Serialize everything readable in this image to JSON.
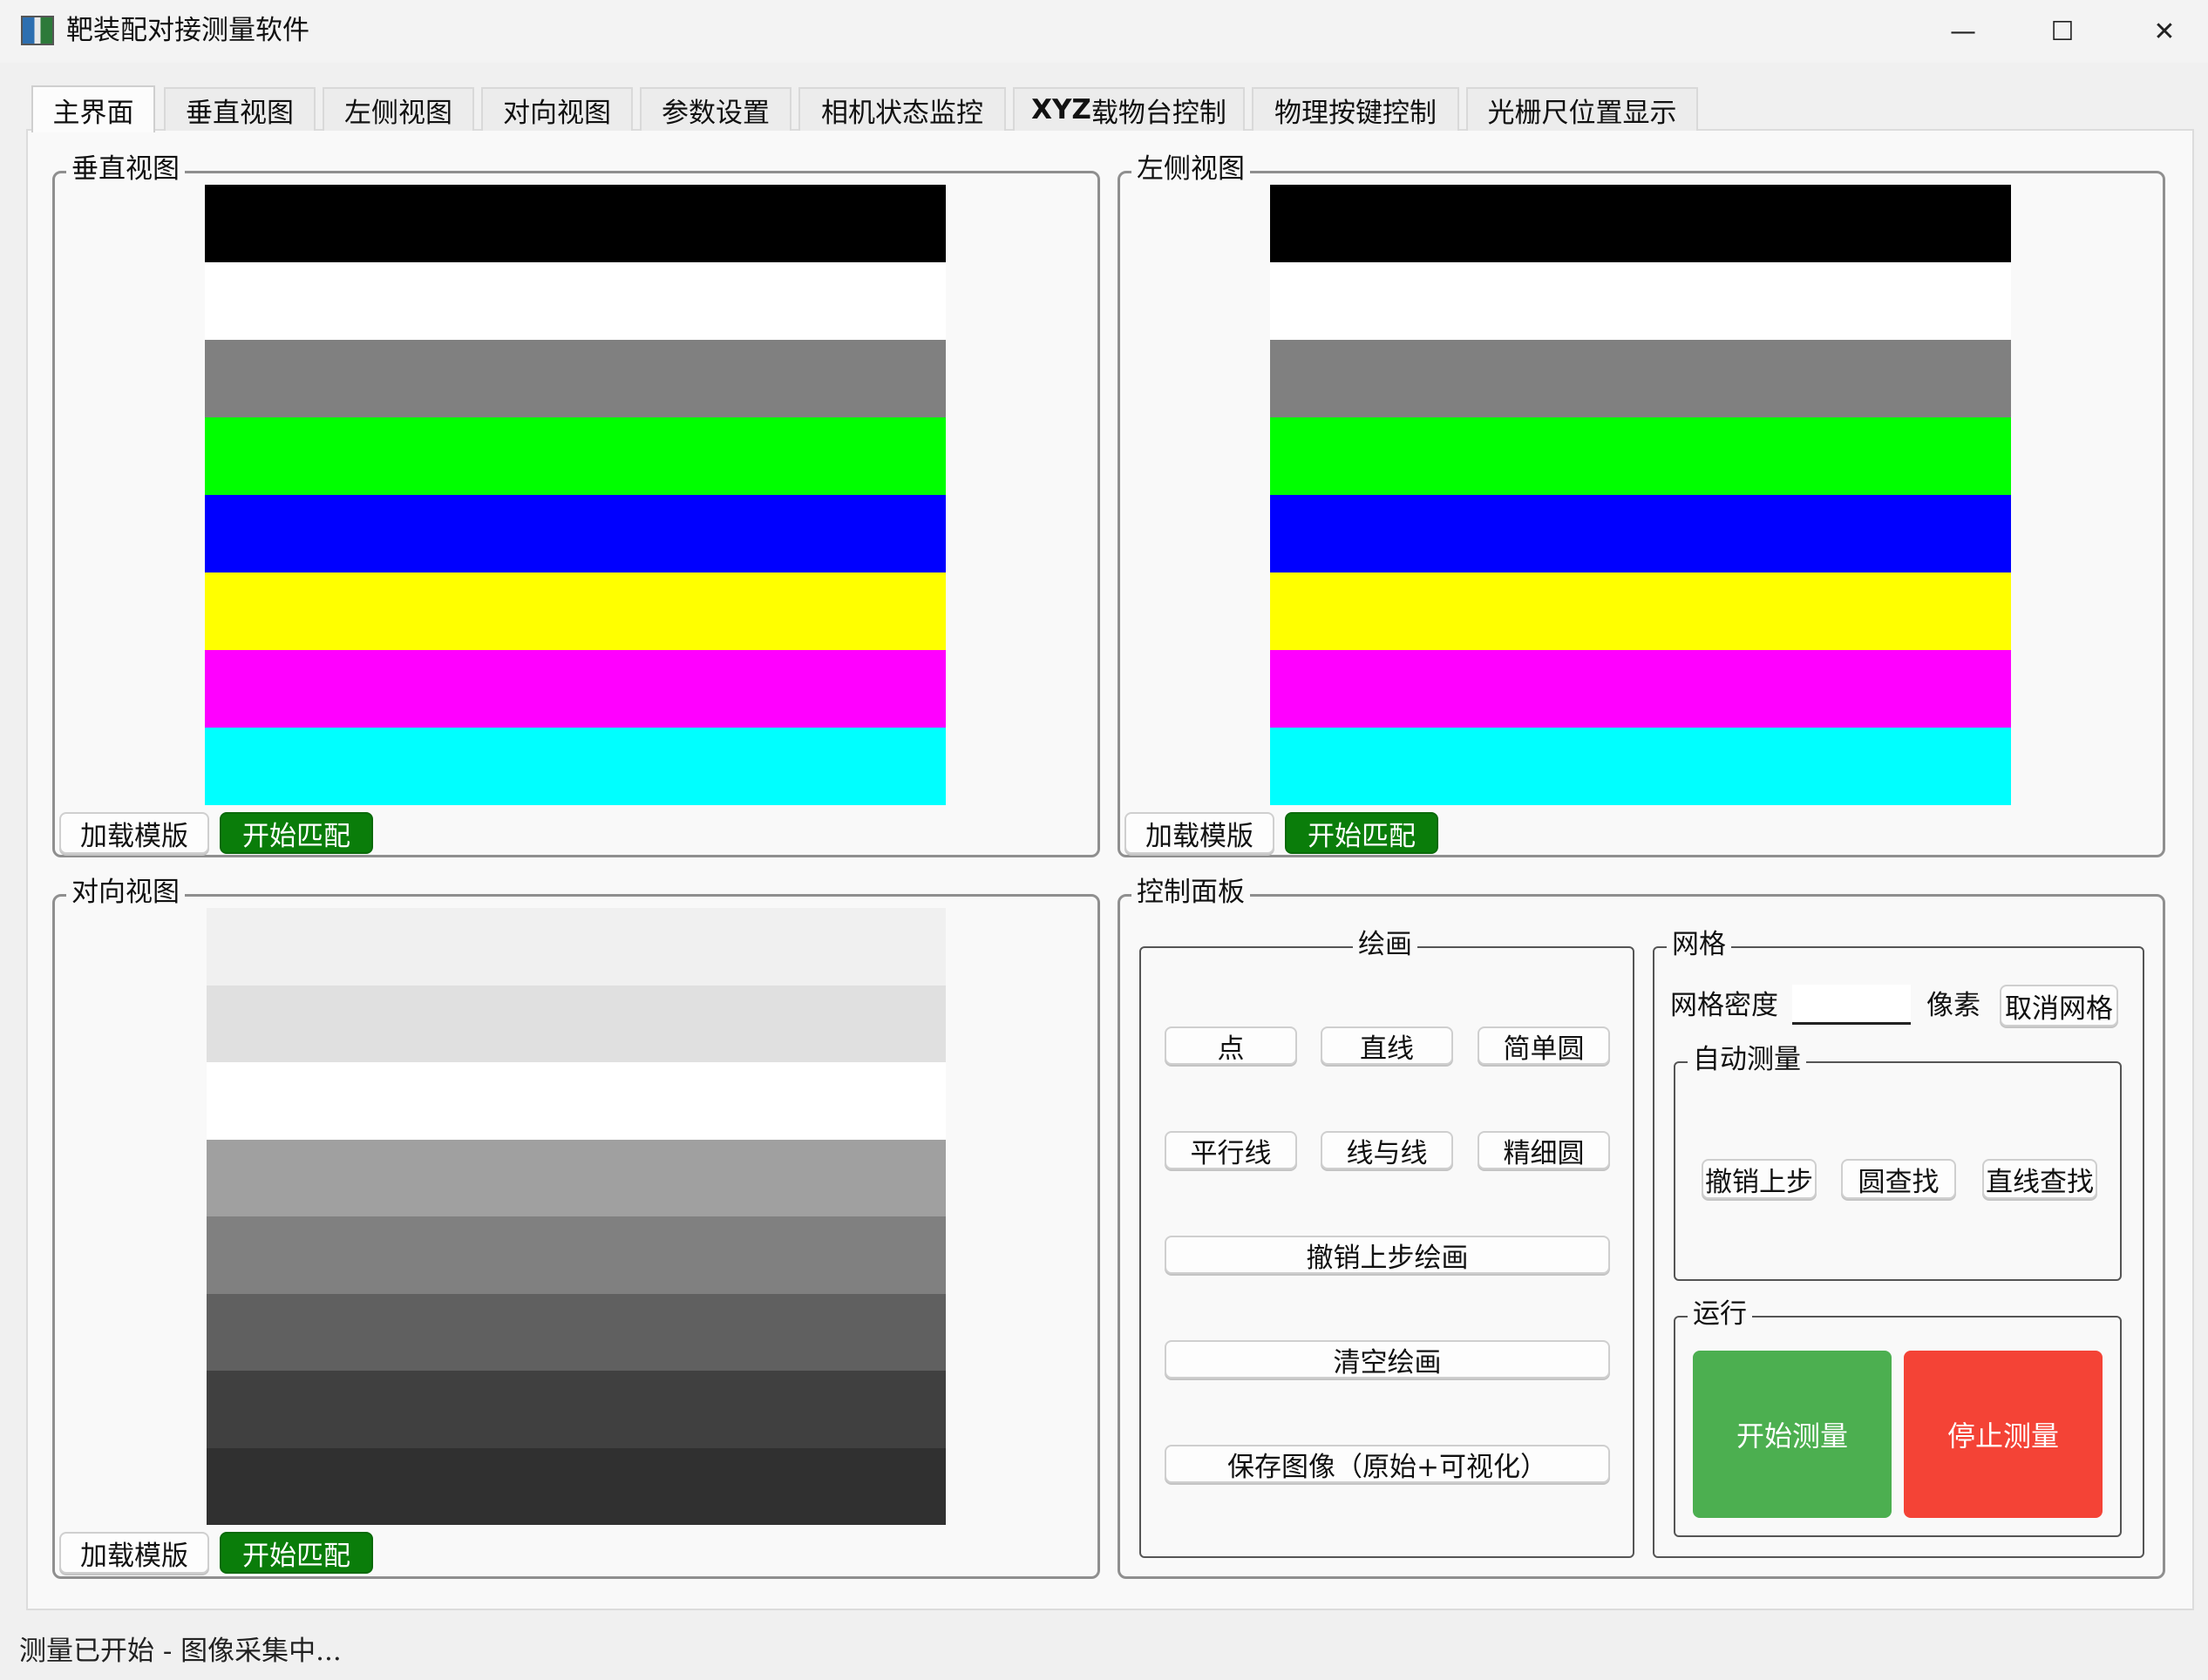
{
  "window": {
    "title": "靶装配对接测量软件",
    "minimize_glyph": "—",
    "maximize_glyph": "☐",
    "close_glyph": "✕"
  },
  "tabs": [
    {
      "label": "主界面",
      "active": true
    },
    {
      "label": "垂直视图"
    },
    {
      "label": "左侧视图"
    },
    {
      "label": "对向视图"
    },
    {
      "label": "参数设置"
    },
    {
      "label": "相机状态监控"
    },
    {
      "label_bold": "XYZ",
      "label": "载物台控制"
    },
    {
      "label": "物理按键控制"
    },
    {
      "label": "光栅尺位置显示"
    }
  ],
  "views": {
    "vertical": {
      "title": "垂直视图",
      "bands": [
        "#000000",
        "#ffffff",
        "#808080",
        "#00ff00",
        "#0000ff",
        "#ffff00",
        "#ff00ff",
        "#00ffff"
      ],
      "load_template_label": "加载模版",
      "start_match_label": "开始匹配"
    },
    "left": {
      "title": "左侧视图",
      "bands": [
        "#000000",
        "#ffffff",
        "#808080",
        "#00ff00",
        "#0000ff",
        "#ffff00",
        "#ff00ff",
        "#00ffff"
      ],
      "load_template_label": "加载模版",
      "start_match_label": "开始匹配"
    },
    "opposite": {
      "title": "对向视图",
      "bands": [
        "#f0f0f0",
        "#e0e0e0",
        "#ffffff",
        "#a0a0a0",
        "#808080",
        "#606060",
        "#404040",
        "#303030"
      ],
      "load_template_label": "加载模版",
      "start_match_label": "开始匹配"
    }
  },
  "control_panel": {
    "title": "控制面板",
    "drawing": {
      "title": "绘画",
      "point": "点",
      "line": "直线",
      "simple_circle": "简单圆",
      "parallel_lines": "平行线",
      "line_to_line": "线与线",
      "fine_circle": "精细圆",
      "undo_drawing": "撤销上步绘画",
      "clear_drawing": "清空绘画",
      "save_image": "保存图像（原始+可视化）"
    },
    "grid": {
      "title": "网格",
      "density_label": "网格密度",
      "density_value": "",
      "unit": "像素",
      "cancel_grid": "取消网格"
    },
    "auto_measure": {
      "title": "自动测量",
      "undo": "撤销上步",
      "circle_find": "圆查找",
      "line_find": "直线查找"
    },
    "run": {
      "title": "运行",
      "start": "开始测量",
      "stop": "停止测量"
    }
  },
  "status_bar": "测量已开始 - 图像采集中...",
  "colors": {
    "match_green": "#0a7d0a",
    "start_green": "#4caf50",
    "stop_red": "#f44336"
  }
}
